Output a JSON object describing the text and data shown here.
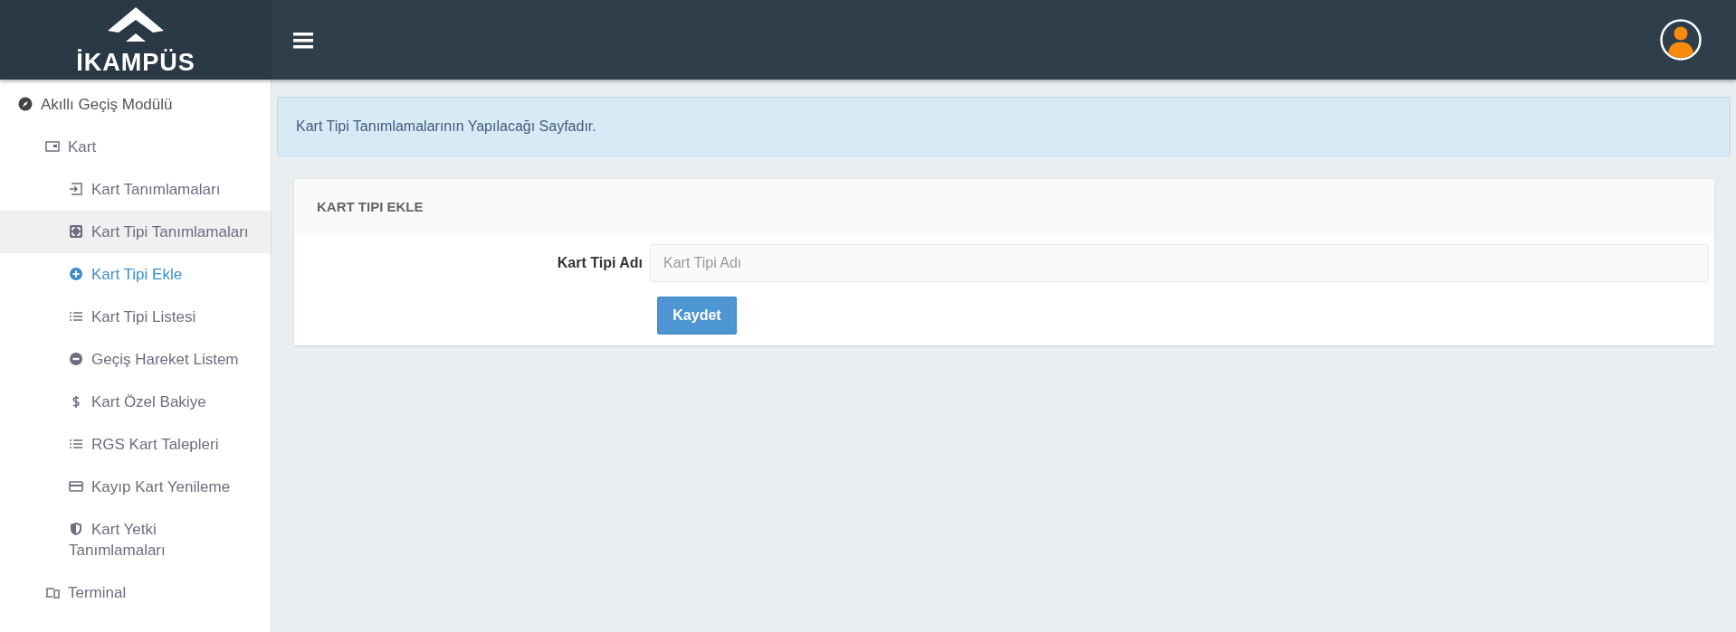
{
  "header": {
    "logo_text": "İKAMPÜS"
  },
  "sidebar": {
    "items": [
      {
        "label": "Akıllı Geçiş Modülü",
        "children": [
          {
            "label": "Kart",
            "children": [
              {
                "label": "Kart Tanımlamaları",
                "selected": false,
                "highlighted": false
              },
              {
                "label": "Kart Tipi Tanımlamaları",
                "selected": false,
                "highlighted": true
              },
              {
                "label": "Kart Tipi Ekle",
                "selected": true,
                "highlighted": false
              },
              {
                "label": "Kart Tipi Listesi",
                "selected": false,
                "highlighted": false
              },
              {
                "label": "Geçiş Hareket Listem",
                "selected": false,
                "highlighted": false
              },
              {
                "label": "Kart Özel Bakiye",
                "selected": false,
                "highlighted": false
              },
              {
                "label": "RGS Kart Talepleri",
                "selected": false,
                "highlighted": false
              },
              {
                "label": "Kayıp Kart Yenileme",
                "selected": false,
                "highlighted": false
              },
              {
                "label": "Kart Yetki Tanımlamaları",
                "selected": false,
                "highlighted": false
              }
            ]
          },
          {
            "label": "Terminal"
          }
        ]
      }
    ]
  },
  "alert": {
    "text": "Kart Tipi Tanımlamalarının Yapılacağı Sayfadır."
  },
  "form": {
    "title": "KART TIPI EKLE",
    "fields": [
      {
        "label": "Kart Tipi Adı",
        "placeholder": "Kart Tipi Adı"
      }
    ],
    "submit": "Kaydet"
  }
}
